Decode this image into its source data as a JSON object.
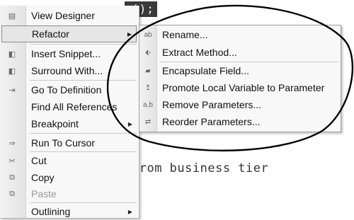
{
  "editor": {
    "top_code": "();",
    "code_line": "from business tier"
  },
  "context_menu": {
    "items": [
      {
        "label": "View Designer",
        "icon": "view-designer-icon",
        "glyph": "▤"
      },
      {
        "label": "Refactor",
        "icon": "",
        "glyph": "",
        "submenu": true,
        "selected": true
      },
      {
        "label": "Insert Snippet...",
        "icon": "insert-snippet-icon",
        "glyph": "◧"
      },
      {
        "label": "Surround With...",
        "icon": "surround-with-icon",
        "glyph": "◧"
      },
      {
        "label": "Go To Definition",
        "icon": "go-to-definition-icon",
        "glyph": "⇥"
      },
      {
        "label": "Find All References",
        "icon": "",
        "glyph": ""
      },
      {
        "label": "Breakpoint",
        "icon": "",
        "glyph": "",
        "submenu": true
      },
      {
        "label": "Run To Cursor",
        "icon": "run-to-cursor-icon",
        "glyph": "⇒"
      },
      {
        "label": "Cut",
        "icon": "cut-icon",
        "glyph": "✂"
      },
      {
        "label": "Copy",
        "icon": "copy-icon",
        "glyph": "⧉"
      },
      {
        "label": "Paste",
        "icon": "paste-icon",
        "glyph": "⧉",
        "disabled": true
      },
      {
        "label": "Outlining",
        "icon": "",
        "glyph": "",
        "submenu": true
      }
    ]
  },
  "refactor_submenu": {
    "items": [
      {
        "label": "Rename...",
        "icon": "rename-icon",
        "glyph": "ab"
      },
      {
        "label": "Extract Method...",
        "icon": "extract-method-icon",
        "glyph": "⬖"
      },
      {
        "label": "Encapsulate Field...",
        "icon": "encapsulate-field-icon",
        "glyph": "▰"
      },
      {
        "label": "Promote Local Variable to Parameter",
        "icon": "promote-variable-icon",
        "glyph": "↥"
      },
      {
        "label": "Remove Parameters...",
        "icon": "remove-parameters-icon",
        "glyph": "a,b"
      },
      {
        "label": "Reorder Parameters...",
        "icon": "reorder-parameters-icon",
        "glyph": "⇄"
      }
    ]
  },
  "colors": {
    "menu_bg": "#f8f8f8",
    "selection_bg": "#e6e6e6",
    "annotation_stroke": "#000000"
  }
}
